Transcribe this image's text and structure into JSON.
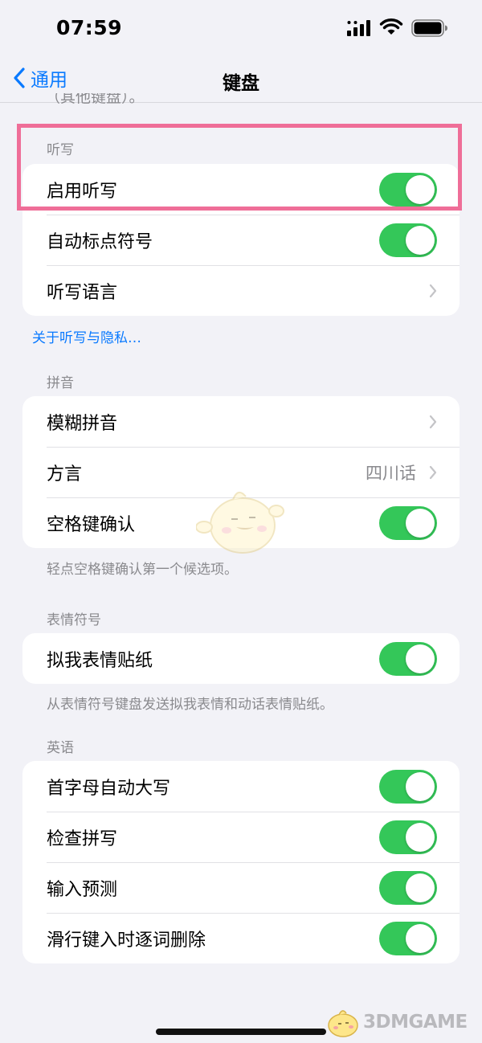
{
  "status_bar": {
    "time": "07:59",
    "signal_icon": "cellular-signal-icon",
    "wifi_icon": "wifi-icon",
    "battery_icon": "battery-icon"
  },
  "nav": {
    "back_label": "通用",
    "back_icon": "chevron-left-icon",
    "title": "键盘"
  },
  "clipped_previous_footer": "（其他键盘）。",
  "dictation": {
    "header": "听写",
    "rows": [
      {
        "label": "启用听写",
        "toggle": true
      },
      {
        "label": "自动标点符号",
        "toggle": true
      },
      {
        "label": "听写语言",
        "chevron": true
      }
    ],
    "footer_link": "关于听写与隐私…"
  },
  "pinyin": {
    "header": "拼音",
    "rows": [
      {
        "label": "模糊拼音",
        "chevron": true
      },
      {
        "label": "方言",
        "value": "四川话",
        "chevron": true
      },
      {
        "label": "空格键确认",
        "toggle": true
      }
    ],
    "footer": "轻点空格键确认第一个候选项。"
  },
  "emoji": {
    "header": "表情符号",
    "rows": [
      {
        "label": "拟我表情贴纸",
        "toggle": true
      }
    ],
    "footer": "从表情符号键盘发送拟我表情和动话表情贴纸。"
  },
  "english": {
    "header": "英语",
    "rows": [
      {
        "label": "首字母自动大写",
        "toggle": true
      },
      {
        "label": "检查拼写",
        "toggle": true
      },
      {
        "label": "输入预测",
        "toggle": true
      },
      {
        "label": "滑行键入时逐词删除",
        "toggle": true
      }
    ]
  },
  "watermark": {
    "text": "3DMGAME"
  },
  "colors": {
    "accent_blue": "#0a7aff",
    "toggle_green": "#34c759",
    "highlight_pink": "#ef6e98",
    "background": "#f2f2f7"
  }
}
